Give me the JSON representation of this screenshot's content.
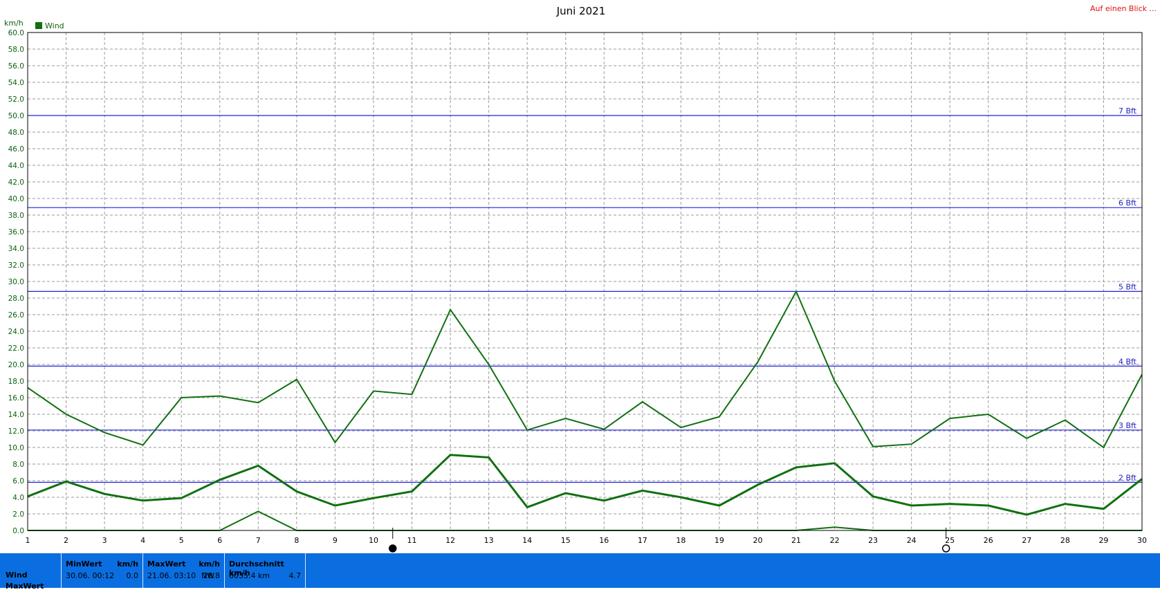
{
  "title": "Juni 2021",
  "header_link": "Auf einen Blick ...",
  "colors": {
    "series": "#107010",
    "bft_line": "#2020e0",
    "bft_label": "#2020c0",
    "grid": "#9a9a9a",
    "link": "#e01010",
    "stats_bg": "#0a6ee0"
  },
  "chart_data": {
    "type": "line",
    "unit_label": "km/h",
    "legend": [
      {
        "name": "Wind",
        "color": "#107010"
      }
    ],
    "x": [
      1,
      2,
      3,
      4,
      5,
      6,
      7,
      8,
      9,
      10,
      11,
      12,
      13,
      14,
      15,
      16,
      17,
      18,
      19,
      20,
      21,
      22,
      23,
      24,
      25,
      26,
      27,
      28,
      29,
      30
    ],
    "xlim": [
      1,
      30
    ],
    "ylim": [
      0,
      60
    ],
    "ytick_step": 2,
    "grid": true,
    "series": [
      {
        "role": "max",
        "values": [
          17.2,
          14.0,
          11.8,
          10.3,
          16.0,
          16.2,
          15.4,
          18.2,
          10.6,
          16.8,
          16.4,
          26.6,
          20.0,
          12.1,
          13.5,
          12.2,
          15.5,
          12.4,
          13.7,
          20.3,
          28.8,
          18.0,
          10.1,
          10.4,
          13.5,
          14.0,
          11.1,
          13.3,
          10.0,
          18.8
        ]
      },
      {
        "role": "avg",
        "values": [
          4.1,
          5.9,
          4.4,
          3.6,
          3.9,
          6.1,
          7.8,
          4.7,
          3.0,
          3.9,
          4.7,
          9.1,
          8.8,
          2.8,
          4.5,
          3.6,
          4.8,
          4.0,
          3.0,
          5.5,
          7.6,
          8.1,
          4.1,
          3.0,
          3.2,
          3.0,
          1.9,
          3.2,
          2.6,
          6.2
        ]
      },
      {
        "role": "min",
        "values": [
          0,
          0,
          0,
          0,
          0,
          0,
          2.3,
          0,
          0,
          0,
          0,
          0,
          0,
          0,
          0,
          0,
          0,
          0,
          0,
          0,
          0,
          0.4,
          0,
          0,
          0,
          0,
          0,
          0,
          0,
          0
        ]
      }
    ],
    "beaufort_lines": [
      {
        "label": "2 Bft",
        "value": 5.8
      },
      {
        "label": "3 Bft",
        "value": 12.1
      },
      {
        "label": "4 Bft",
        "value": 19.8
      },
      {
        "label": "5 Bft",
        "value": 28.8
      },
      {
        "label": "6 Bft",
        "value": 38.9
      },
      {
        "label": "7 Bft",
        "value": 50.0
      }
    ],
    "moon_phases": [
      {
        "x": 10.5,
        "phase": "full-moon-icon",
        "filled": true
      },
      {
        "x": 24.9,
        "phase": "new-moon-icon",
        "filled": false
      }
    ]
  },
  "stats": {
    "row_labels": [
      "Wind",
      "MaxWert"
    ],
    "min": {
      "header": "MinWert",
      "unit": "km/h",
      "date_time": "30.06.  00:12",
      "value": "0.0"
    },
    "max": {
      "header": "MaxWert",
      "unit": "km/h",
      "date_time": "21.06.  03:10",
      "direction": "NW",
      "value": "28.8"
    },
    "avg": {
      "header": "Durchschnitt km/h",
      "total": "6035.4 km",
      "value": "4.7"
    }
  }
}
